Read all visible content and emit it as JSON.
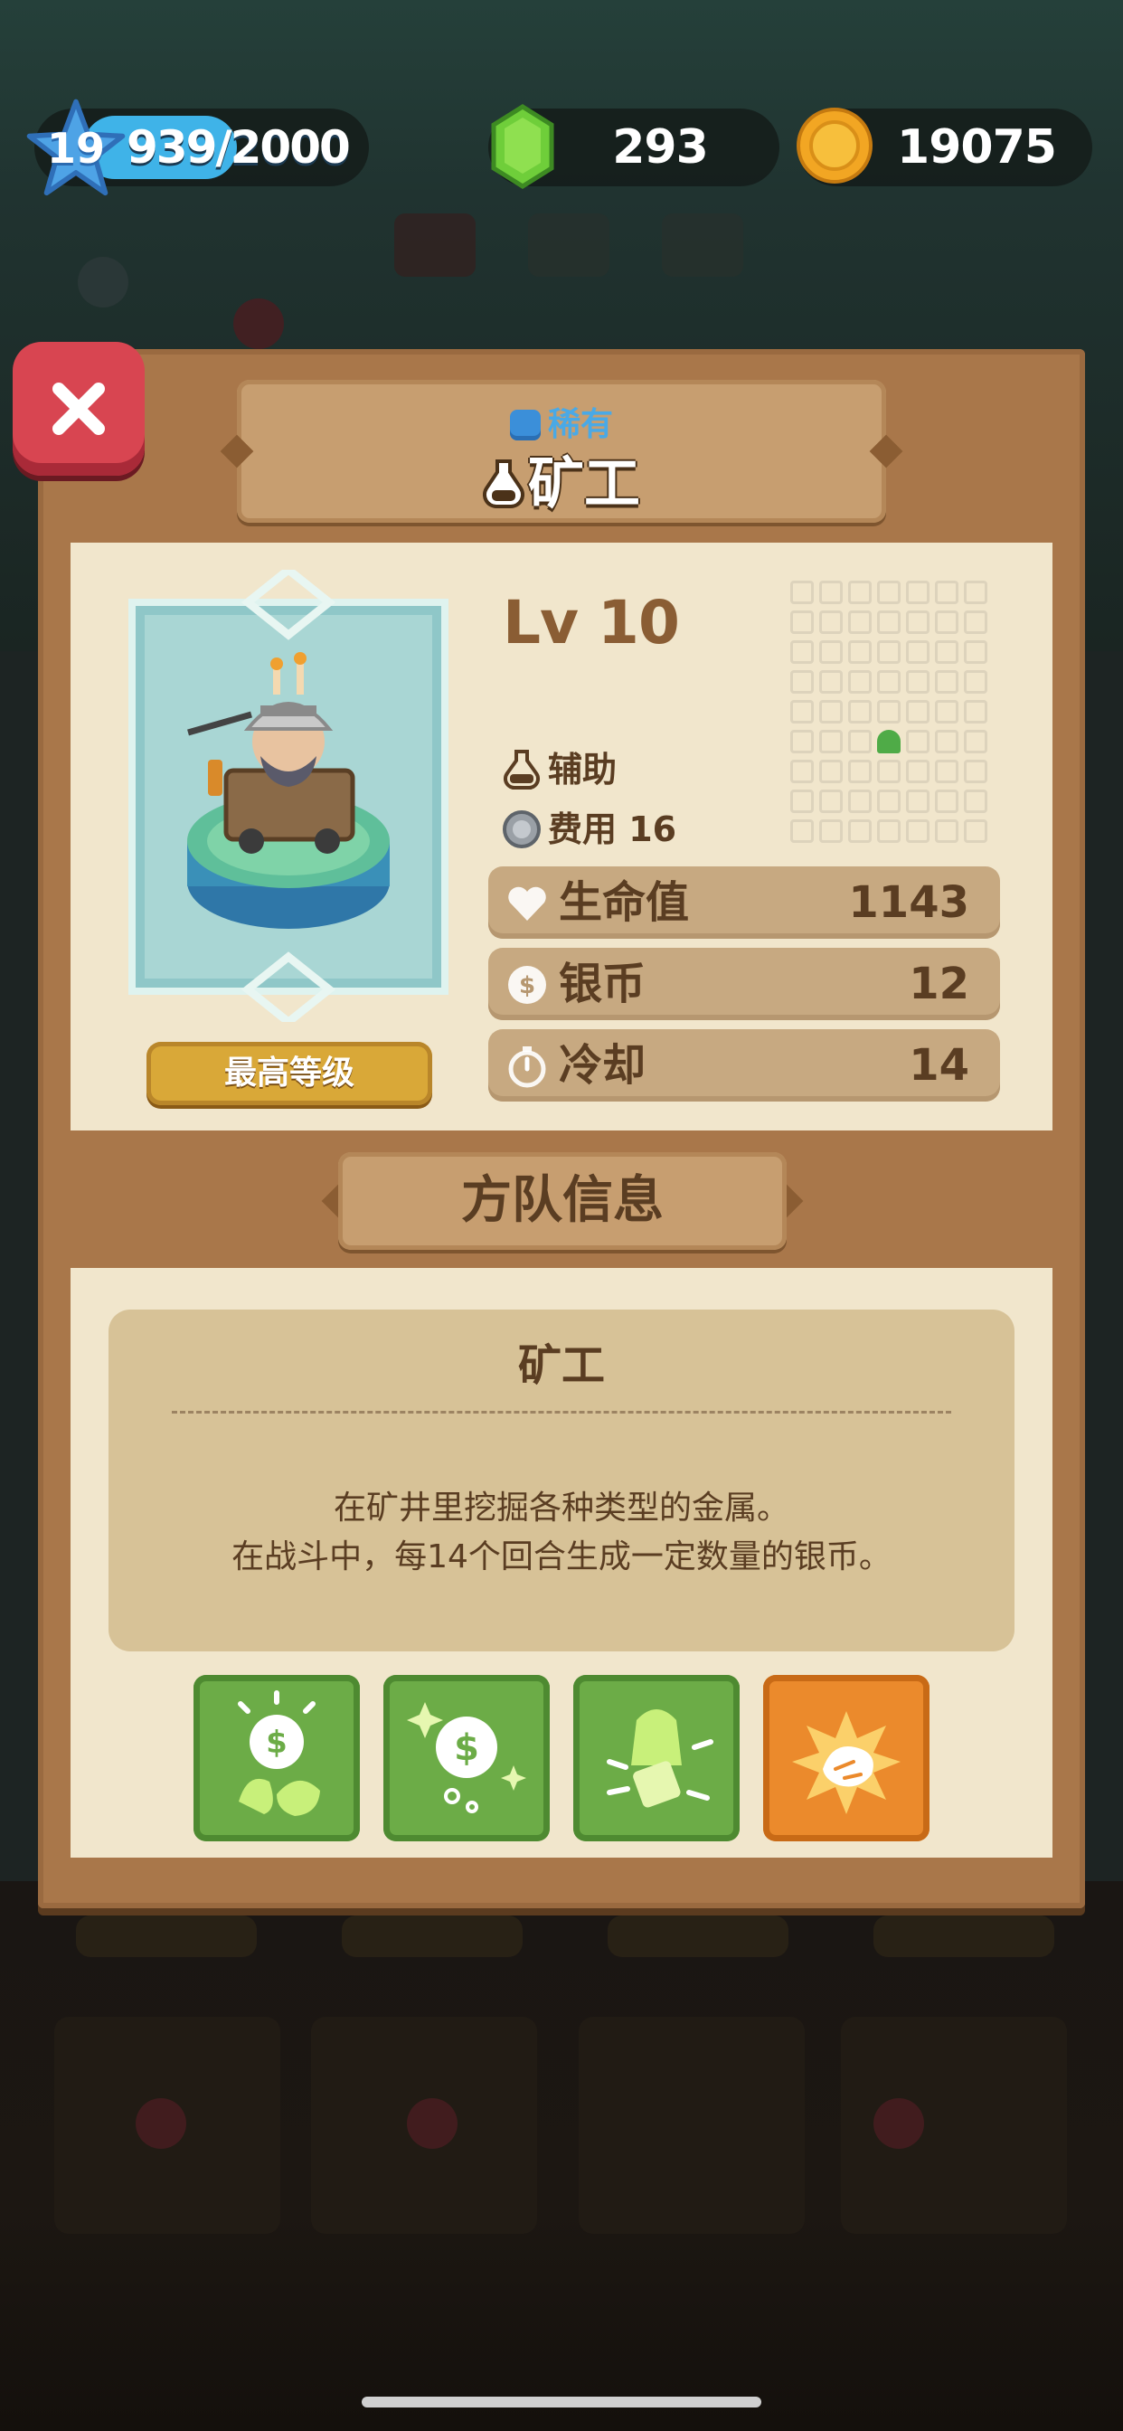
{
  "hud": {
    "player_level": "19",
    "xp": "939/2000",
    "xp_progress": 0.4695,
    "gems": "293",
    "coins": "19075"
  },
  "unit": {
    "rarity": "稀有",
    "name": "矿工",
    "level": "Lv 10",
    "max_level_label": "最高等级",
    "role": "辅助",
    "cost": "费用 16",
    "stats": [
      {
        "label": "生命值",
        "value": "1143",
        "icon": "heart-icon"
      },
      {
        "label": "银币",
        "value": "12",
        "icon": "silver-coin-icon"
      },
      {
        "label": "冷却",
        "value": "14",
        "icon": "stopwatch-icon"
      }
    ]
  },
  "squad": {
    "section_title": "方队信息",
    "title": "矿工",
    "desc_line1": "在矿井里挖掘各种类型的金属。",
    "desc_line2": "在战斗中，每14个回合生成一定数量的银币。",
    "skills": [
      {
        "icon": "money-bag-rocks-icon",
        "color": "#6cac47"
      },
      {
        "icon": "sparkle-coin-icon",
        "color": "#6cac47"
      },
      {
        "icon": "lantern-strike-icon",
        "color": "#6cac47"
      },
      {
        "icon": "ore-burst-icon",
        "color": "#eb8a2c"
      }
    ]
  },
  "colors": {
    "panel": "#a9774a",
    "card": "#f1e6cc",
    "close": "#d84551",
    "rarity": "#4aa9e6"
  }
}
